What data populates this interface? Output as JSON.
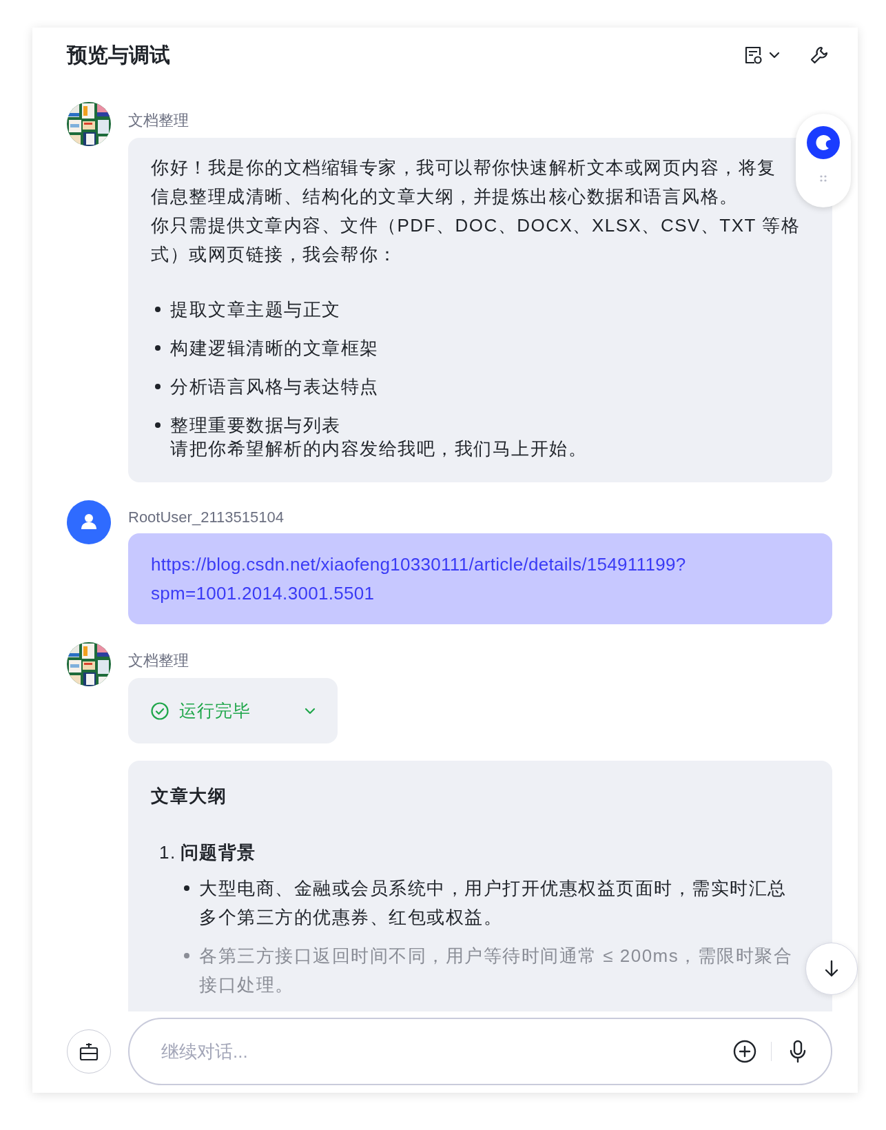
{
  "header": {
    "title": "预览与调试"
  },
  "messages": [
    {
      "kind": "bot",
      "sender": "文档整理",
      "paragraphs": [
        "你好！我是你的文档缩辑专家，我可以帮你快速解析文本或网页内容，将复",
        "信息整理成清晰、结构化的文章大纲，并提炼出核心数据和语言风格。",
        "你只需提供文章内容、文件（PDF、DOC、DOCX、XLSX、CSV、TXT 等格式）或网页链接，我会帮你："
      ],
      "bullets": [
        "提取文章主题与正文",
        "构建逻辑清晰的文章框架",
        "分析语言风格与表达特点",
        "整理重要数据与列表"
      ],
      "closing": "请把你希望解析的内容发给我吧，我们马上开始。"
    },
    {
      "kind": "user",
      "sender": "RootUser_2113515104",
      "link": "https://blog.csdn.net/xiaofeng10330111/article/details/154911199?spm=1001.2014.3001.5501"
    },
    {
      "kind": "result",
      "sender": "文档整理",
      "status": "运行完毕",
      "expanded": false,
      "heading": "文章大纲",
      "sections": [
        {
          "number": "1.",
          "title": "问题背景",
          "bullets": [
            {
              "text": "大型电商、金融或会员系统中，用户打开优惠权益页面时，需实时汇总多个第三方的优惠券、红包或权益。",
              "faded": false
            },
            {
              "text": "各第三方接口返回时间不同，用户等待时间通常 ≤ 200ms，需限时聚合接口处理。",
              "faded": true
            }
          ]
        }
      ]
    }
  ],
  "input": {
    "placeholder": "继续对话..."
  }
}
